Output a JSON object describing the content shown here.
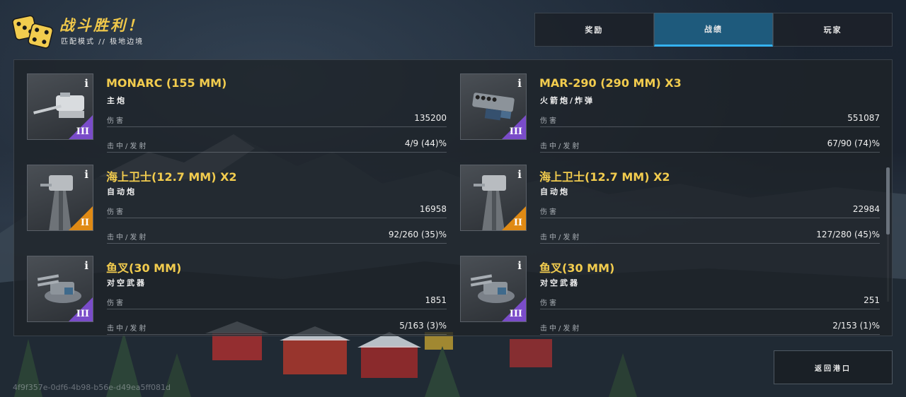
{
  "header": {
    "title": "战斗胜利！",
    "subtitle": "匹配模式 // 极地边境",
    "logo_icon": "dice-icon"
  },
  "tabs": [
    {
      "label": "奖励",
      "active": false
    },
    {
      "label": "战绩",
      "active": true
    },
    {
      "label": "玩家",
      "active": false
    }
  ],
  "weapons": [
    {
      "name": "MONARC (155 MM)",
      "type": "主炮",
      "damage_label": "伤害",
      "damage": "135200",
      "hits_label": "击中/发射",
      "hits": "4/9 (44)%",
      "tier": "III",
      "tier_color": "#7a4cc9",
      "icon": "main-cannon-icon"
    },
    {
      "name": "MAR-290 (290 MM) X3",
      "type": "火箭炮/炸弹",
      "damage_label": "伤害",
      "damage": "551087",
      "hits_label": "击中/发射",
      "hits": "67/90 (74)%",
      "tier": "III",
      "tier_color": "#7a4cc9",
      "icon": "rocket-launcher-icon"
    },
    {
      "name": "海上卫士(12.7 MM) X2",
      "type": "自动炮",
      "damage_label": "伤害",
      "damage": "16958",
      "hits_label": "击中/发射",
      "hits": "92/260 (35)%",
      "tier": "II",
      "tier_color": "#e08a14",
      "icon": "autocannon-icon"
    },
    {
      "name": "海上卫士(12.7 MM) X2",
      "type": "自动炮",
      "damage_label": "伤害",
      "damage": "22984",
      "hits_label": "击中/发射",
      "hits": "127/280 (45)%",
      "tier": "II",
      "tier_color": "#e08a14",
      "icon": "autocannon-icon"
    },
    {
      "name": "鱼叉(30 MM)",
      "type": "对空武器",
      "damage_label": "伤害",
      "damage": "1851",
      "hits_label": "击中/发射",
      "hits": "5/163 (3)%",
      "tier": "III",
      "tier_color": "#7a4cc9",
      "icon": "anti-air-icon"
    },
    {
      "name": "鱼叉(30 MM)",
      "type": "对空武器",
      "damage_label": "伤害",
      "damage": "251",
      "hits_label": "击中/发射",
      "hits": "2/153 (1)%",
      "tier": "III",
      "tier_color": "#7a4cc9",
      "icon": "anti-air-icon"
    }
  ],
  "return_button": {
    "label": "返回港口"
  },
  "session_id": "4f9f357e-0df6-4b98-b56e-d49ea5ff081d"
}
